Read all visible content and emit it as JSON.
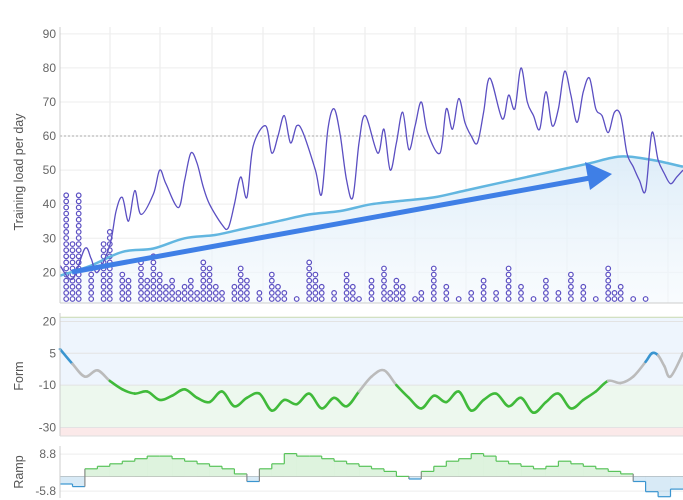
{
  "chart_data": [
    {
      "type": "line",
      "ylabel": "Training load per day",
      "ylim": [
        11,
        92
      ],
      "y_ticks": [
        "20",
        "30",
        "40",
        "50",
        "60",
        "70",
        "80",
        "90"
      ],
      "x_range": [
        0,
        100
      ],
      "reference_line": 60,
      "series": [
        {
          "role": "daily training load",
          "color": "#5b4fc2",
          "x": [
            0,
            2,
            4,
            5,
            6,
            8,
            9,
            10,
            11,
            12,
            13,
            15,
            16,
            17,
            19,
            20,
            21,
            22,
            23,
            24,
            26,
            27,
            28,
            29,
            30,
            31,
            33,
            34,
            35,
            36,
            37,
            38,
            39,
            41,
            42,
            43,
            44,
            45,
            46,
            47,
            48,
            49,
            51,
            52,
            53,
            54,
            55,
            56,
            57,
            58,
            59,
            61,
            62,
            63,
            64,
            65,
            66,
            67,
            68,
            69,
            71,
            72,
            73,
            74,
            75,
            76,
            77,
            78,
            79,
            80,
            81,
            82,
            83,
            84,
            85,
            86,
            87,
            88,
            89,
            90,
            91,
            92,
            93,
            94,
            95,
            96,
            97,
            98,
            99,
            100
          ],
          "y": [
            22,
            18,
            27,
            24,
            20,
            28,
            38,
            42,
            35,
            44,
            37,
            43,
            50,
            46,
            39,
            47,
            55,
            52,
            45,
            40,
            34,
            33,
            40,
            48,
            42,
            57,
            63,
            55,
            60,
            66,
            58,
            63,
            61,
            50,
            43,
            62,
            68,
            60,
            47,
            42,
            58,
            66,
            55,
            62,
            50,
            58,
            67,
            56,
            63,
            70,
            61,
            55,
            68,
            62,
            71,
            64,
            60,
            58,
            67,
            77,
            65,
            72,
            68,
            80,
            70,
            66,
            62,
            73,
            63,
            68,
            79,
            72,
            64,
            73,
            77,
            68,
            66,
            61,
            67,
            66,
            55,
            51,
            47,
            44,
            61,
            53,
            49,
            46,
            48,
            50
          ]
        },
        {
          "role": "7-day average",
          "color": "#62b6e0",
          "x": [
            0,
            5,
            10,
            15,
            20,
            25,
            30,
            35,
            40,
            45,
            50,
            55,
            60,
            65,
            70,
            75,
            80,
            85,
            90,
            95,
            100
          ],
          "y": [
            19,
            22,
            26,
            27,
            30,
            31,
            33,
            35,
            37,
            38,
            40,
            41,
            42,
            44,
            46,
            48,
            50,
            52,
            54,
            53,
            51
          ]
        }
      ],
      "dot_columns": {
        "color": "#5b4fc2",
        "x": [
          1,
          2,
          3,
          5,
          7,
          8,
          10,
          11,
          13,
          14,
          15,
          16,
          17,
          18,
          19,
          20,
          21,
          22,
          23,
          24,
          25,
          26,
          28,
          29,
          30,
          32,
          34,
          35,
          36,
          38,
          40,
          41,
          42,
          44,
          46,
          47,
          48,
          50,
          52,
          53,
          54,
          55,
          57,
          58,
          60,
          62,
          64,
          66,
          68,
          70,
          72,
          74,
          76,
          78,
          80,
          82,
          84,
          86,
          88,
          89,
          90,
          92,
          94
        ],
        "dots": [
          18,
          10,
          18,
          6,
          10,
          12,
          5,
          4,
          7,
          4,
          8,
          5,
          3,
          4,
          2,
          3,
          4,
          2,
          7,
          6,
          3,
          2,
          3,
          6,
          4,
          2,
          5,
          3,
          2,
          1,
          7,
          5,
          3,
          2,
          5,
          3,
          1,
          4,
          6,
          2,
          4,
          3,
          1,
          2,
          6,
          3,
          1,
          2,
          4,
          2,
          6,
          3,
          1,
          4,
          2,
          5,
          3,
          1,
          6,
          2,
          3,
          1,
          1
        ]
      }
    },
    {
      "type": "line",
      "ylabel": "Form",
      "ylim": [
        -34,
        24
      ],
      "y_ticks": [
        "20",
        "5",
        "-10",
        "-30"
      ],
      "x": [
        0,
        2,
        4,
        6,
        8,
        10,
        12,
        14,
        16,
        18,
        20,
        22,
        24,
        26,
        28,
        30,
        32,
        34,
        36,
        38,
        40,
        42,
        44,
        46,
        48,
        50,
        52,
        54,
        56,
        58,
        60,
        62,
        64,
        66,
        68,
        70,
        72,
        74,
        76,
        78,
        80,
        82,
        84,
        86,
        88,
        90,
        92,
        94,
        95,
        96,
        97,
        98,
        100
      ],
      "y": [
        7,
        0,
        -6,
        -3,
        -8,
        -12,
        -14,
        -13,
        -17,
        -15,
        -12,
        -16,
        -18,
        -13,
        -20,
        -16,
        -14,
        -22,
        -17,
        -19,
        -14,
        -21,
        -16,
        -20,
        -13,
        -6,
        -3,
        -10,
        -16,
        -21,
        -15,
        -18,
        -13,
        -22,
        -17,
        -14,
        -20,
        -16,
        -23,
        -18,
        -14,
        -21,
        -17,
        -13,
        -8,
        -9,
        -6,
        1,
        5,
        4,
        -1,
        -6,
        5
      ],
      "colors": {
        "positive": "#3a95d0",
        "neutral": "#bbbbbb",
        "negative": "#40ba3a"
      }
    },
    {
      "type": "area",
      "ylabel": "Ramp",
      "ylim": [
        -8.5,
        12
      ],
      "y_ticks": [
        "8.8",
        "-5.8"
      ],
      "x": [
        0,
        2,
        4,
        6,
        8,
        10,
        12,
        14,
        16,
        18,
        20,
        22,
        24,
        26,
        28,
        30,
        32,
        34,
        36,
        38,
        40,
        42,
        44,
        46,
        48,
        50,
        52,
        54,
        56,
        58,
        60,
        62,
        64,
        66,
        68,
        70,
        72,
        74,
        76,
        78,
        80,
        82,
        84,
        86,
        88,
        90,
        92,
        94,
        96,
        98,
        100
      ],
      "y": [
        -3,
        -4,
        3,
        4,
        5,
        6,
        7,
        8,
        8,
        7,
        6,
        5,
        4,
        3,
        1,
        -2,
        3,
        5,
        9,
        8,
        8,
        7,
        6,
        5,
        4,
        3,
        2,
        0,
        -1,
        2,
        4,
        6,
        7,
        9,
        8,
        6,
        5,
        4,
        3,
        4,
        6,
        5,
        4,
        3,
        2,
        1,
        -2,
        -6,
        -8,
        -5,
        -2
      ],
      "colors": {
        "positive": "#59c35a",
        "negative": "#3a95d0"
      }
    }
  ]
}
